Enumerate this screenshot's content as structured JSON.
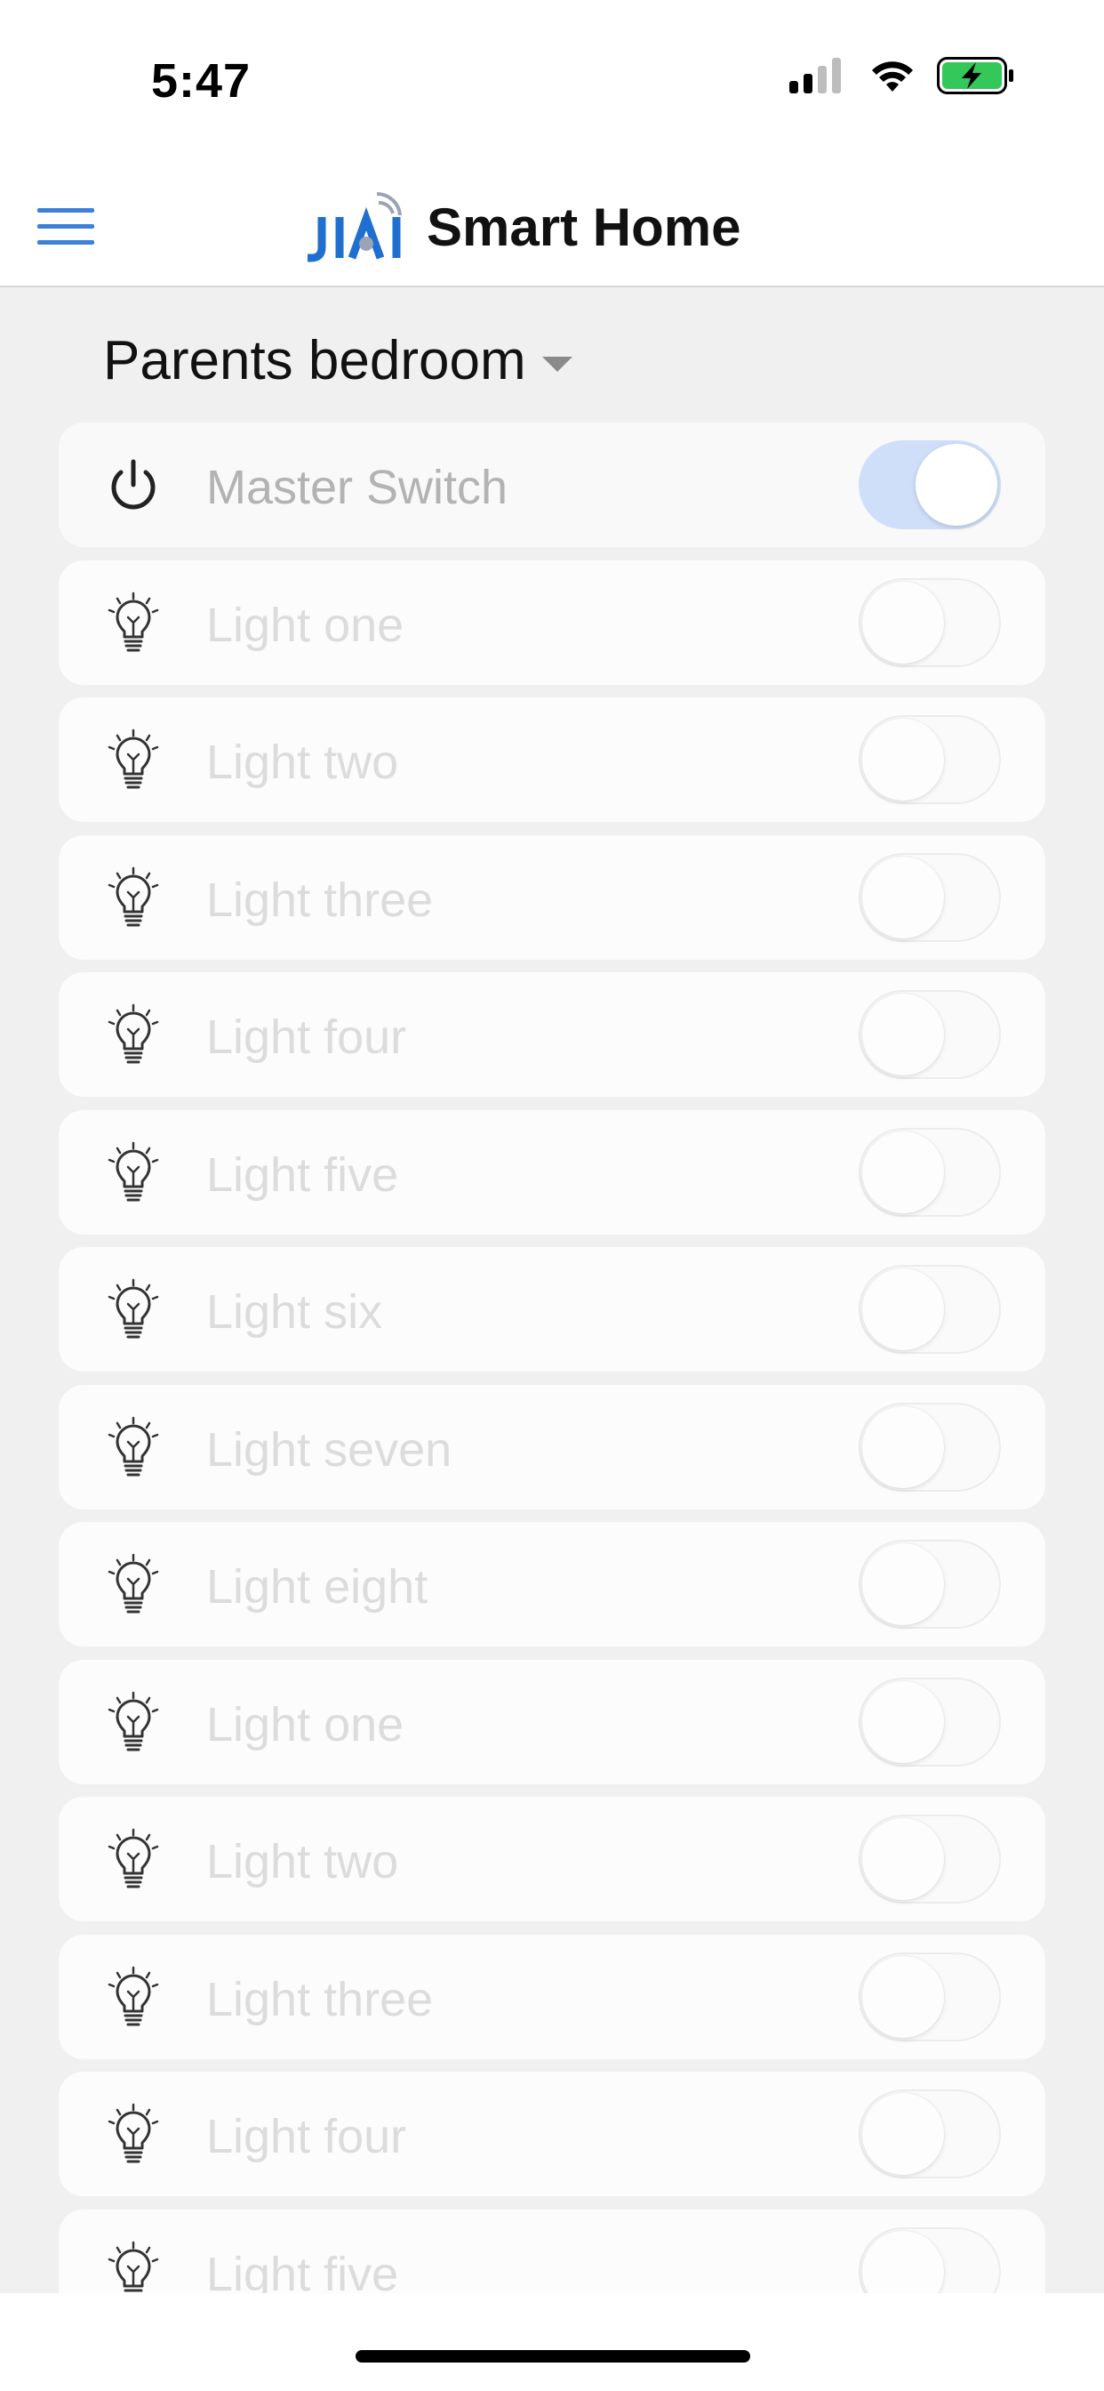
{
  "status_bar": {
    "time": "5:47",
    "icons": [
      "cellular-signal-icon",
      "wifi-icon",
      "battery-charging-icon"
    ]
  },
  "header": {
    "menu_icon": "hamburger-menu-icon",
    "logo_icon": "jiai-logo",
    "title": "Smart Home",
    "accent_color": "#3d7fd9"
  },
  "room": {
    "name": "Parents bedroom",
    "dropdown_icon": "caret-down-icon"
  },
  "master": {
    "label": "Master Switch",
    "icon": "power-icon",
    "on": true,
    "toggle_on_color": "#cfdff9"
  },
  "lights": [
    {
      "label": "Light one",
      "icon": "lightbulb-icon",
      "on": false
    },
    {
      "label": "Light two",
      "icon": "lightbulb-icon",
      "on": false
    },
    {
      "label": "Light three",
      "icon": "lightbulb-icon",
      "on": false
    },
    {
      "label": "Light four",
      "icon": "lightbulb-icon",
      "on": false
    },
    {
      "label": "Light five",
      "icon": "lightbulb-icon",
      "on": false
    },
    {
      "label": "Light six",
      "icon": "lightbulb-icon",
      "on": false
    },
    {
      "label": "Light seven",
      "icon": "lightbulb-icon",
      "on": false
    },
    {
      "label": "Light eight",
      "icon": "lightbulb-icon",
      "on": false
    },
    {
      "label": "Light one",
      "icon": "lightbulb-icon",
      "on": false
    },
    {
      "label": "Light two",
      "icon": "lightbulb-icon",
      "on": false
    },
    {
      "label": "Light three",
      "icon": "lightbulb-icon",
      "on": false
    },
    {
      "label": "Light four",
      "icon": "lightbulb-icon",
      "on": false
    },
    {
      "label": "Light five",
      "icon": "lightbulb-icon",
      "on": false
    }
  ]
}
